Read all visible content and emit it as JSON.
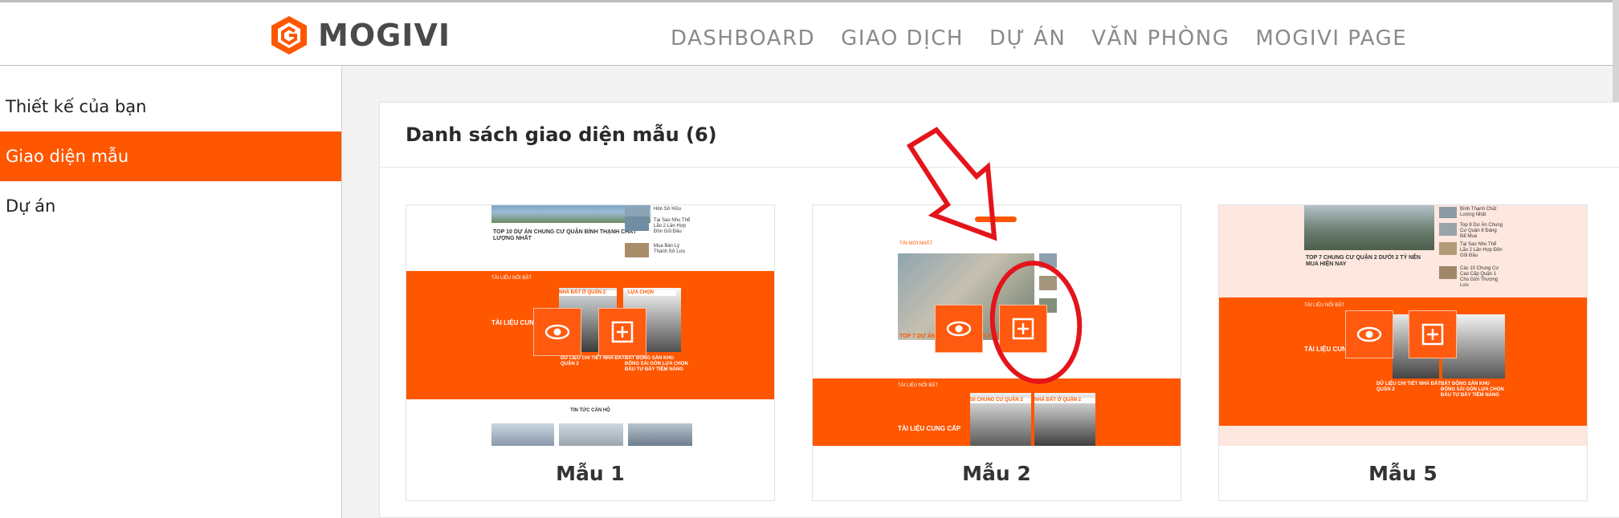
{
  "header": {
    "logo_text": "MOGIVI",
    "nav": [
      "DASHBOARD",
      "GIAO DỊCH",
      "DỰ ÁN",
      "VĂN PHÒNG",
      "MOGIVI PAGE"
    ]
  },
  "sidebar": {
    "items": [
      {
        "label": "Thiết kế của bạn",
        "active": false
      },
      {
        "label": "Giao diện mẫu",
        "active": true
      },
      {
        "label": "Dự án",
        "active": false
      }
    ]
  },
  "main": {
    "title": "Danh sách giao diện mẫu (6)",
    "cards": [
      {
        "label": "Mẫu 1",
        "preview": {
          "headline": "TOP 10 DỰ ÁN CHUNG CƯ QUẬN BÌNH THẠNH CHẤT LƯỢNG NHẤT",
          "side_items": [
            "Hôn Sở Hữu",
            "Tại Sao Nhu Thể Lão 2 Lần Hợp Đồn Gối Đầu",
            "Mua Bán Lý Thanh Sở Lưu"
          ],
          "section": "TÀI LIỆU NỔI BẬT",
          "block_title": "TÀI LIỆU CUNG",
          "item1": "DỮ LIỆU CHI TIẾT NHÀ ĐẤT QUẬN 2",
          "item2": "BẤT ĐỘNG SẢN KHU ĐÔNG SÀI GÒN LỰA CHỌN ĐẦU TƯ ĐẦY TIỀM NĂNG",
          "badge1": "NHÀ ĐẤT Ở QUẬN 2",
          "badge2": "LỰA CHỌN",
          "footer": "TIN TỨC CĂN HỘ"
        }
      },
      {
        "label": "Mẫu 2",
        "preview": {
          "section_top": "TIN MỚI NHẤT",
          "headline": "TOP 7 DỰ ÁN CHUNG CƯ QUẬN 2 BẤT ĐỘNG SẢN",
          "section": "TÀI LIỆU NỔI BẬT",
          "block_title": "TÀI LIỆU CUNG CẤP",
          "badge1": "50 CHUNG CƯ QUẬN 2",
          "badge2": "NHÀ ĐẤT Ở QUẬN 2"
        }
      },
      {
        "label": "Mẫu 5",
        "preview": {
          "headline": "TOP 7 CHUNG CƯ QUẬN 2 DƯỚI 2 TỶ NÊN MUA HIỆN NAY",
          "side_items": [
            "Bình Thạnh Chất Lượng Nhất",
            "Top 8 Dự Án Chung Cư Quận 8 Đáng Để Mua",
            "Tại Sao Nhu Thể Lão 2 Lần Hợp Đồn Gối Đầu",
            "Các 10 Chung Cư Cao Cấp Quận 1 Cho Giới Thượng Lưu"
          ],
          "section": "TÀI LIỆU NỔI BẬT",
          "block_title": "TÀI LIỆU CUNG",
          "item1": "DỮ LIỆU CHI TIẾT NHÀ ĐẤT QUẬN 2",
          "item2": "BẤT ĐỘNG SẢN KHU ĐÔNG SÀI GÒN LỰA CHỌN ĐẦU TƯ ĐẦY TIỀM NĂNG"
        }
      }
    ]
  },
  "icons": {
    "view": "eye-icon",
    "add": "plus-square-icon"
  },
  "colors": {
    "accent": "#ff5600",
    "annotation": "#e4141b"
  }
}
